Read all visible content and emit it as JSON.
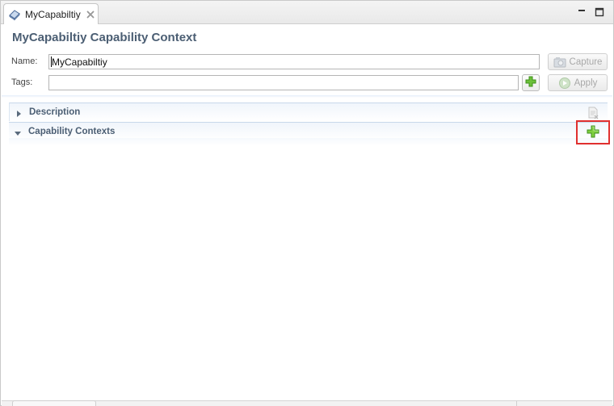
{
  "tab": {
    "label": "MyCapabiltiy",
    "icon": "capability-context-icon"
  },
  "window_controls": {
    "minimize_icon": "minimize-icon",
    "maximize_icon": "maximize-icon"
  },
  "form": {
    "title": "MyCapabiltiy Capability Context",
    "name_label": "Name:",
    "name_value": "MyCapabiltiy",
    "tags_label": "Tags:",
    "tags_value": "",
    "capture_label": "Capture",
    "apply_label": "Apply"
  },
  "sections": {
    "description": {
      "title": "Description",
      "expanded": false
    },
    "capability_contexts": {
      "title": "Capability Contexts",
      "expanded": true
    }
  },
  "colors": {
    "title_text": "#4b5e73",
    "highlight_box": "#e0302f",
    "plus_green": "#4caf2c"
  }
}
